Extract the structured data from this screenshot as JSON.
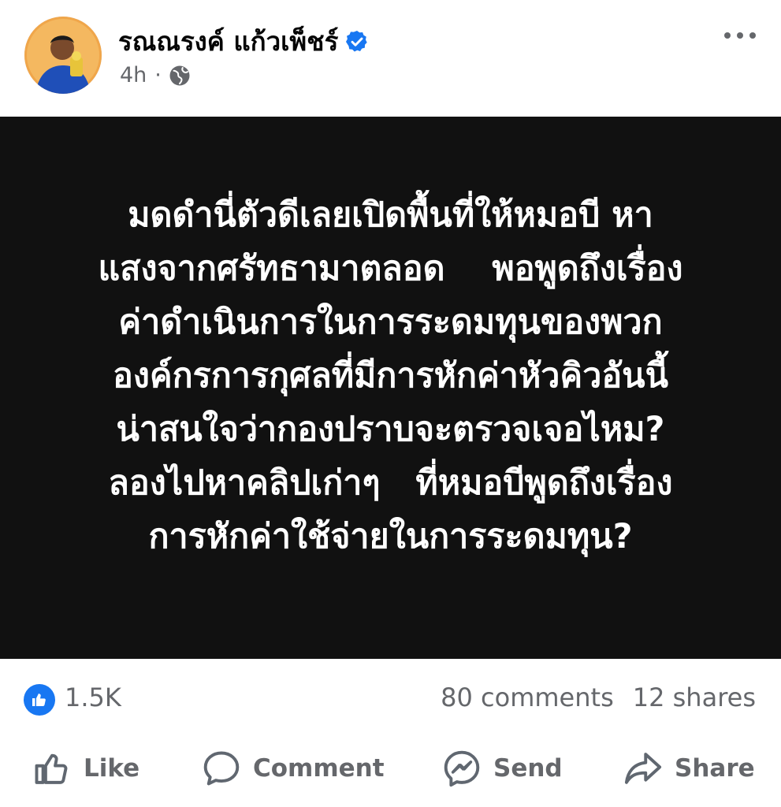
{
  "header": {
    "author_name": "รณณรงค์ แก้วเพ็ชร์",
    "time": "4h",
    "separator": "·",
    "avatar_icon": "user-avatar",
    "verified_icon": "verified-badge-icon",
    "privacy_icon": "globe-icon",
    "more_icon": "more-options-icon"
  },
  "post": {
    "background_color": "#111111",
    "text_color": "#ffffff",
    "lines": [
      "มดดำนี่ตัวดีเลยเปิดพื้นที่ให้หมอบี หา",
      "แสงจากศรัทธามาตลอด    พอพูดถึงเรื่อง",
      "ค่าดำเนินการในการระดมทุนของพวก",
      "องค์กรการกุศลที่มีการหักค่าหัวคิวอันนี้",
      "น่าสนใจว่ากองปราบจะตรวจเจอไหม?",
      "ลองไปหาคลิปเก่าๆ   ที่หมอบีพูดถึงเรื่อง",
      "การหักค่าใช้จ่ายในการระดมทุน?"
    ]
  },
  "stats": {
    "likes": "1.5K",
    "comments": "80 comments",
    "shares": "12 shares",
    "like_icon": "thumbs-up-icon",
    "accent": "#1877f2"
  },
  "actions": {
    "like_label": "Like",
    "comment_label": "Comment",
    "send_label": "Send",
    "share_label": "Share"
  }
}
